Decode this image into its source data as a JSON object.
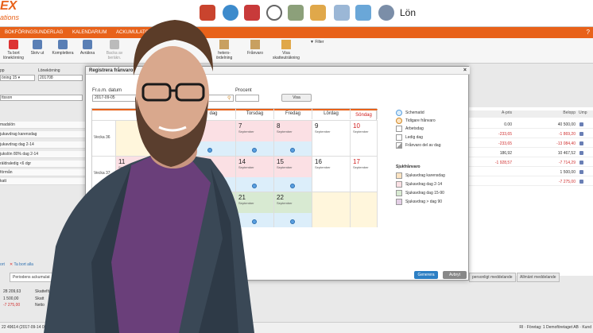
{
  "app": {
    "logo_text": "EX",
    "logo_sub": "ations",
    "page_label": "Lön"
  },
  "menubar": {
    "items": [
      "BOKFÖRINGSUNDERLAG",
      "KALENDARIUM",
      "ACKUMULATOR"
    ],
    "help": "?"
  },
  "toolbar": {
    "buttons": [
      {
        "label": "Ta bort\nlönekörning",
        "color": "#d33"
      },
      {
        "label": "Skriv ut",
        "color": "#5a7fb5"
      },
      {
        "label": "Komplettera",
        "color": "#5a7fb5"
      },
      {
        "label": "Avräkna",
        "color": "#5a7fb5"
      },
      {
        "label": "Backa av\nberäkn.",
        "color": "#aaa"
      }
    ],
    "partial1": "heters-\nördelning",
    "partial2": "Frånvaro",
    "partial3": "Visa\nskatteuträkning",
    "filter": "Filter"
  },
  "left": {
    "group_label": "pp",
    "run_label": "Lönekörning",
    "group_value": "öning 15 ▾",
    "run_value": "201708",
    "name": "ttsson",
    "rows": [
      "madslön",
      "jukavdrag karensdag",
      "jukavdrag dag 2-14",
      "jukslön 80% dag 2-14",
      "räldraledig <6 dgr",
      "förmån",
      "katt"
    ],
    "links": [
      "ort",
      "Ta bort alla"
    ]
  },
  "right": {
    "headers": [
      "A-pris",
      "Belopp",
      "Ump"
    ],
    "rows": [
      {
        "a": "0.00",
        "b": "40 500,00",
        "red": false
      },
      {
        "a": "-233,65",
        "b": "-1 869,20",
        "red": true
      },
      {
        "a": "-233,65",
        "b": "-13 084,40",
        "red": true
      },
      {
        "a": "186,92",
        "b": "10 467,52",
        "red": false
      },
      {
        "a": "-1 928,57",
        "b": "-7 714,29",
        "red": true
      },
      {
        "a": "",
        "b": "1 500,00",
        "red": false
      },
      {
        "a": "",
        "b": "-7 275,00",
        "red": true
      }
    ]
  },
  "bottom": {
    "tab_left": "Periodens ackumulat",
    "tabs_right": [
      "personligt meddelande",
      "Allmänt meddelande"
    ],
    "values": [
      "28 209,63",
      "1 500,00",
      "-7 275,00"
    ],
    "labels": [
      "Skatteför",
      "Skatt",
      "Netto"
    ],
    "status_left": "22 49614 (2017-09-14 08",
    "status_right": "RI · Företag: 1 Demoföretaget AB · Kund"
  },
  "dialog": {
    "title": "Registrera frånvaro",
    "close": "×",
    "from_label": "Fr.o.m. datum",
    "from_value": "2017-09-05",
    "percent_label": "Procent",
    "visa": "Visa",
    "generate": "Generera",
    "cancel": "Avbryt"
  },
  "calendar": {
    "headers": [
      "dag",
      "Torsdag",
      "Fredag",
      "Lördag",
      "Söndag"
    ],
    "month": "September",
    "weeks": [
      "Vecka 36",
      "Vecka 37"
    ],
    "days": [
      {
        "n": "7",
        "m": "September"
      },
      {
        "n": "8",
        "m": "September"
      },
      {
        "n": "9",
        "m": "September"
      },
      {
        "n": "10",
        "m": "September"
      },
      {
        "n": "11",
        "m": "September"
      },
      {
        "n": "3",
        "m": "September"
      },
      {
        "n": "14",
        "m": "September"
      },
      {
        "n": "15",
        "m": "September"
      },
      {
        "n": "16",
        "m": "September"
      },
      {
        "n": "17",
        "m": "September"
      },
      {
        "n": "21",
        "m": "September"
      },
      {
        "n": "22",
        "m": "September"
      }
    ]
  },
  "legend": {
    "items": [
      "Schematid",
      "Tidigare frånvaro",
      "Arbetsdag",
      "Ledig dag",
      "Frånvaro del av dag"
    ],
    "sick_title": "Sjukfrånvaro",
    "sick_items": [
      "Sjukavdrag karensdag",
      "Sjukavdrag dag 2-14",
      "Sjukavdrag dag 15-90",
      "Sjukavdrag > dag 90"
    ],
    "colors": {
      "karens": "#fde4c2",
      "d214": "#fbe0e4",
      "d1590": "#d8ead2",
      "d90": "#e4cfe6"
    }
  }
}
